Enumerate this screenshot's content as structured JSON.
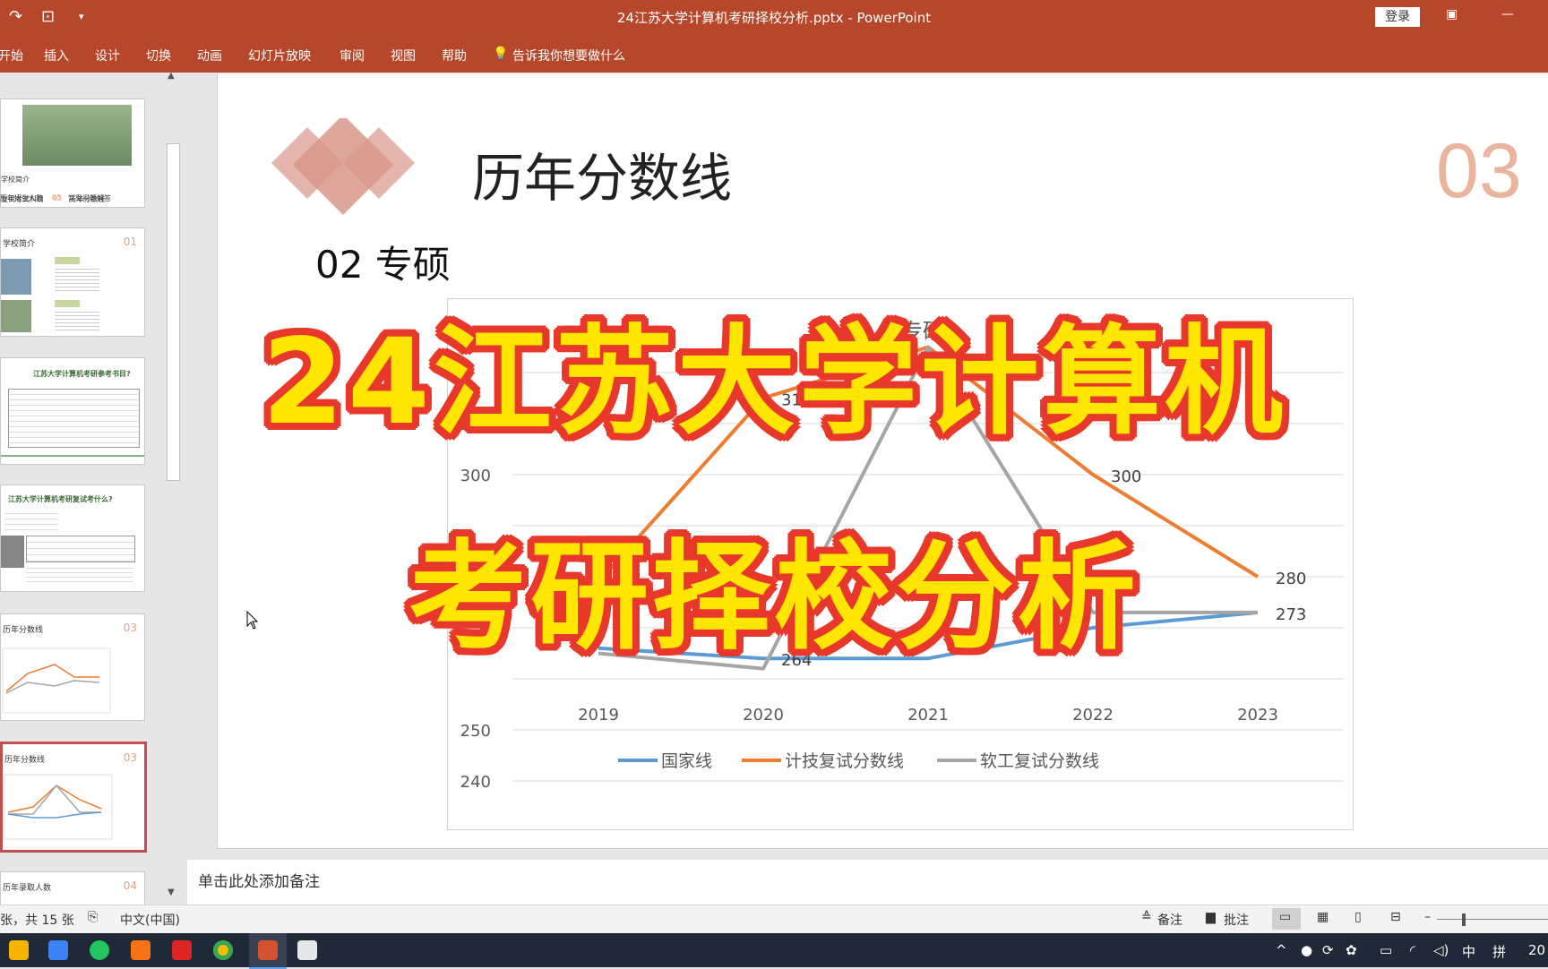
{
  "titlebar": {
    "doc_title": "24江苏大学计算机考研择校分析.pptx  -  PowerPoint",
    "login_label": "登录"
  },
  "ribbon": {
    "tabs": [
      "开始",
      "插入",
      "设计",
      "切换",
      "动画",
      "幻灯片放映",
      "审阅",
      "视图",
      "帮助"
    ],
    "tell_me": "告诉我你想要做什么"
  },
  "thumbnails": {
    "t1": {
      "items": [
        "学校简介",
        "复试考试科目",
        "03",
        "历年分数线",
        "历年招生人数",
        "05",
        "常见问题解答"
      ]
    },
    "t2": {
      "title": "学校简介",
      "num": "01"
    },
    "t3": {
      "title": "江苏大学计算机考研参考书目?"
    },
    "t4": {
      "title": "江苏大学计算机考研复试考什么?"
    },
    "t5": {
      "title": "历年分数线",
      "num": "03"
    },
    "t6": {
      "title": "历年分数线",
      "num": "03"
    },
    "t7": {
      "title": "历年录取人数",
      "num": "04"
    }
  },
  "slide": {
    "heading": "历年分数线",
    "section_number": "03",
    "subheading": "02 专硕",
    "colors": {
      "accent": "#d9968a",
      "number": "#e9b59e"
    }
  },
  "chart_data": {
    "type": "line",
    "title": "专硕",
    "categories": [
      "2019",
      "2020",
      "2021",
      "2022",
      "2023"
    ],
    "y_ticks_visible": [
      310,
      300,
      250,
      240
    ],
    "ylim": [
      240,
      320
    ],
    "series": [
      {
        "name": "国家线",
        "color": "#5b9bd5",
        "values": [
          266,
          264,
          264,
          270,
          273
        ]
      },
      {
        "name": "计技复试分数线",
        "color": "#ed7d31",
        "values": [
          279,
          315,
          325,
          300,
          280
        ]
      },
      {
        "name": "软工复试分数线",
        "color": "#a5a5a5",
        "values": [
          265,
          262,
          325,
          273,
          273
        ]
      }
    ],
    "data_labels": [
      {
        "text": "315",
        "series": 1,
        "point": 1
      },
      {
        "text": "300",
        "series": 1,
        "point": 3
      },
      {
        "text": "280",
        "series": 1,
        "point": 4
      },
      {
        "text": "273",
        "series": 2,
        "point": 4
      },
      {
        "text": "264",
        "series": 0,
        "point": 1
      }
    ],
    "legend_position": "bottom",
    "grid": true
  },
  "overlay": {
    "line1": "24江苏大学计算机",
    "line2": "考研择校分析",
    "fill": "#ffe600",
    "stroke": "#e8382c"
  },
  "notes": {
    "placeholder": "单击此处添加备注"
  },
  "statusbar": {
    "slide_count": "张，共 15 张",
    "language": "中文(中国)",
    "notes_label": "备注",
    "comments_label": "批注"
  },
  "taskbar": {
    "ime": "中",
    "ime2": "拼",
    "clock": "20"
  }
}
